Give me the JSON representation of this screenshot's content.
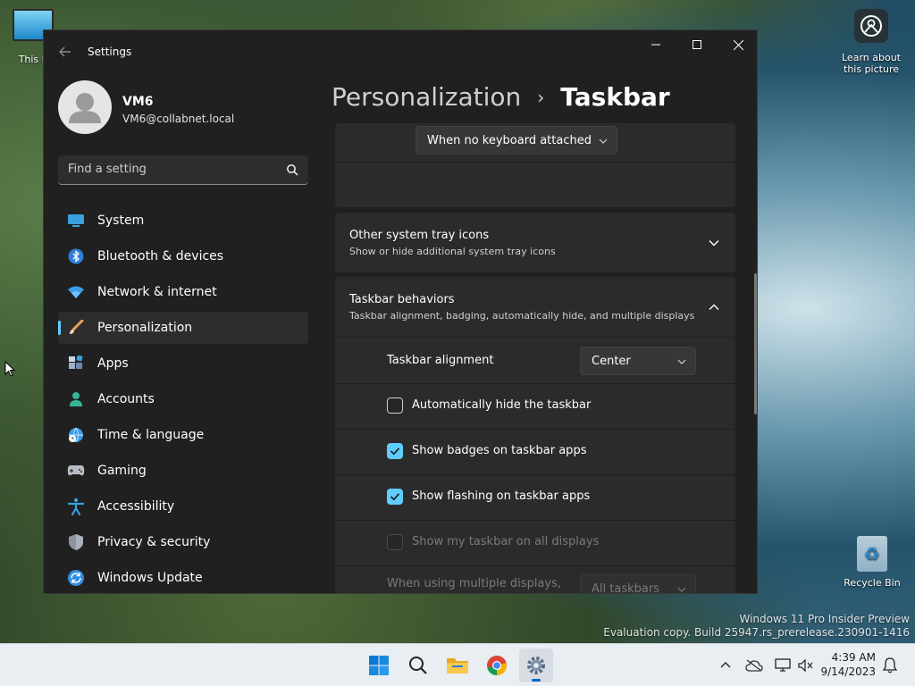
{
  "desktop": {
    "this_pc_label": "This P",
    "learn_label_line1": "Learn about",
    "learn_label_line2": "this picture",
    "recycle_label": "Recycle Bin",
    "watermark_line1": "Windows 11 Pro Insider Preview",
    "watermark_line2": "Evaluation copy. Build 25947.rs_prerelease.230901-1416"
  },
  "window": {
    "title": "Settings",
    "user": {
      "name": "VM6",
      "email": "VM6@collabnet.local"
    },
    "search": {
      "placeholder": "Find a setting"
    },
    "nav": [
      {
        "label": "System",
        "icon": "monitor-icon"
      },
      {
        "label": "Bluetooth & devices",
        "icon": "bluetooth-icon"
      },
      {
        "label": "Network & internet",
        "icon": "wifi-icon"
      },
      {
        "label": "Personalization",
        "icon": "paintbrush-icon",
        "selected": true
      },
      {
        "label": "Apps",
        "icon": "apps-icon"
      },
      {
        "label": "Accounts",
        "icon": "person-icon"
      },
      {
        "label": "Time & language",
        "icon": "globe-clock-icon"
      },
      {
        "label": "Gaming",
        "icon": "gamepad-icon"
      },
      {
        "label": "Accessibility",
        "icon": "accessibility-icon"
      },
      {
        "label": "Privacy & security",
        "icon": "shield-icon"
      },
      {
        "label": "Windows Update",
        "icon": "update-icon"
      }
    ],
    "breadcrumb": {
      "parent": "Personalization",
      "separator": "›",
      "current": "Taskbar"
    }
  },
  "content": {
    "keyboard_dropdown": "When no keyboard attached",
    "other_tray": {
      "title": "Other system tray icons",
      "subtitle": "Show or hide additional system tray icons"
    },
    "behaviors": {
      "title": "Taskbar behaviors",
      "subtitle": "Taskbar alignment, badging, automatically hide, and multiple displays",
      "alignment_label": "Taskbar alignment",
      "alignment_value": "Center",
      "options": [
        {
          "label": "Automatically hide the taskbar",
          "checked": false,
          "disabled": false
        },
        {
          "label": "Show badges on taskbar apps",
          "checked": true,
          "disabled": false
        },
        {
          "label": "Show flashing on taskbar apps",
          "checked": true,
          "disabled": false
        },
        {
          "label": "Show my taskbar on all displays",
          "checked": false,
          "disabled": true
        }
      ],
      "multi_display_label": "When using multiple displays,",
      "multi_display_value": "All taskbars"
    }
  },
  "taskbar": {
    "apps": [
      "start-icon",
      "search-icon",
      "file-explorer-icon",
      "chrome-icon",
      "settings-icon"
    ],
    "time": "4:39 AM",
    "date": "9/14/2023"
  },
  "colors": {
    "accent": "#60cdff",
    "window_bg": "#202020",
    "card_bg": "#2b2b2b"
  }
}
